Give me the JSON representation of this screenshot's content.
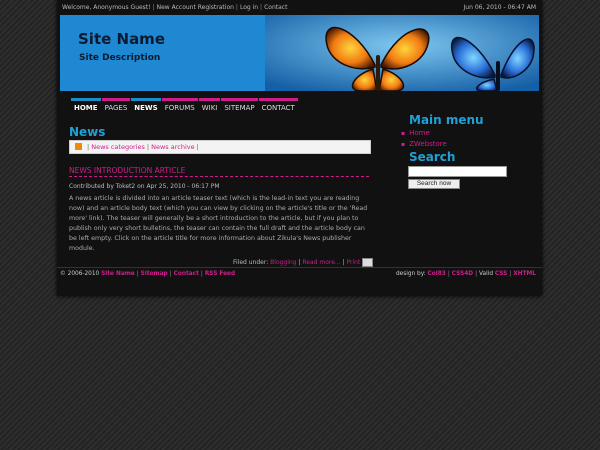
{
  "topbar": {
    "welcome": "Welcome, Anonymous Guest!",
    "links": [
      "New Account Registration",
      "Log in",
      "Contact"
    ],
    "datetime": "Jun 06, 2010 - 06:47 AM"
  },
  "header": {
    "site_name": "Site Name",
    "site_description": "Site Description"
  },
  "nav": {
    "items": [
      {
        "label": "HOME",
        "active": true
      },
      {
        "label": "PAGES"
      },
      {
        "label": "NEWS",
        "active": true
      },
      {
        "label": "FORUMS"
      },
      {
        "label": "WIKI"
      },
      {
        "label": "SITEMAP"
      },
      {
        "label": "CONTACT"
      }
    ]
  },
  "main": {
    "title": "News",
    "newsbar": {
      "categories": "News categories",
      "archive": "News archive"
    },
    "article": {
      "title": "NEWS INTRODUCTION ARTICLE",
      "meta": "Contributed by Toket2 on Apr 25, 2010 - 06:17 PM",
      "body": "A news article is divided into an article teaser text (which is the lead-in text you are reading now) and an article body text (which you can view by clicking on the article's title or the 'Read more' link). The teaser will generally be a short introduction to the article, but if you plan to publish only very short bulletins, the teaser can contain the full draft and the article body can be left empty. Click on the article title for more information about Zikula's News publisher module.",
      "filed_under": "Filed under:",
      "category": "Blogging",
      "read_more": "Read more...",
      "print": "Print"
    }
  },
  "sidebar": {
    "menu_title": "Main menu",
    "menu_items": [
      "Home",
      "ZWebstore"
    ],
    "search_title": "Search",
    "search_button": "Search now"
  },
  "footer": {
    "copyright": "© 2006-2010",
    "site_name": "Site Name",
    "links": [
      "Sitemap",
      "Contact",
      "RSS Feed"
    ],
    "designed_by": "design by:",
    "designer": "Col83",
    "designer2": "CSS4D",
    "valid": "Valid",
    "css": "CSS",
    "xhtml": "XHTML"
  },
  "colors": {
    "accent_pink": "#d01d8c",
    "accent_blue": "#1ea1d6"
  }
}
